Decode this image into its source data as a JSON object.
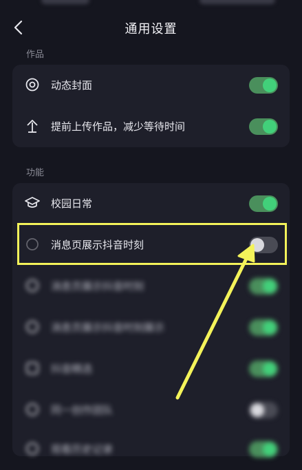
{
  "header": {
    "title": "通用设置",
    "back_icon": "chevron-left-icon"
  },
  "sections": {
    "works": {
      "label": "作品",
      "items": [
        {
          "icon": "dynamic-cover-icon",
          "label": "动态封面",
          "enabled": true
        },
        {
          "icon": "upload-icon",
          "label": "提前上传作品，减少等待时间",
          "enabled": true
        }
      ]
    },
    "features": {
      "label": "功能",
      "items": [
        {
          "icon": "graduation-cap-icon",
          "label": "校园日常",
          "enabled": true
        },
        {
          "icon": "moment-icon",
          "label": "消息页展示抖音时刻",
          "enabled": false,
          "highlighted": true
        }
      ]
    }
  },
  "blurred_rows": [
    {
      "label": "消息页展示抖音时刻",
      "enabled": true
    },
    {
      "label": "消息页展示抖音时刻展示",
      "enabled": true
    },
    {
      "label": "抖音精选",
      "enabled": true
    },
    {
      "label": "同一创作团队",
      "enabled": false
    },
    {
      "label": "观看历史记录",
      "enabled": true
    }
  ],
  "colors": {
    "background": "#15161f",
    "card": "#1e1f2a",
    "toggle_on": "#42d07a",
    "annotation": "#f4f35a"
  }
}
